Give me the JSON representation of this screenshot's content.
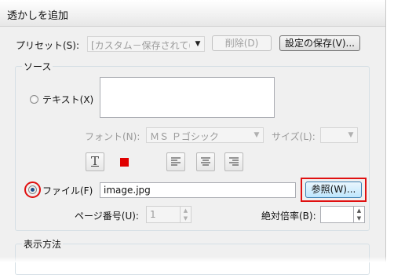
{
  "window": {
    "title": "透かしを追加"
  },
  "preset": {
    "label": "プリセット(S):",
    "value": "[カスタム－保存されて(",
    "delete_label": "削除(D)",
    "save_label": "設定の保存(V)..."
  },
  "source": {
    "group_title": "ソース",
    "text_radio_label": "テキスト(X)",
    "font_label": "フォント(N):",
    "font_value": "ＭＳ Ｐゴシック",
    "size_label": "サイズ(L):",
    "file_radio_label": "ファイル(F)",
    "file_value": "image.jpg",
    "browse_label": "参照(W)...",
    "page_label": "ページ番号(U):",
    "page_value": "1",
    "scale_label": "絶対倍率(B):",
    "underline_icon": "T",
    "color_swatch": "#e00000",
    "selected_radio": "file"
  },
  "display": {
    "group_title": "表示方法"
  },
  "icons": {
    "align_left": "align-left-icon",
    "align_center": "align-center-icon",
    "align_right": "align-right-icon"
  }
}
